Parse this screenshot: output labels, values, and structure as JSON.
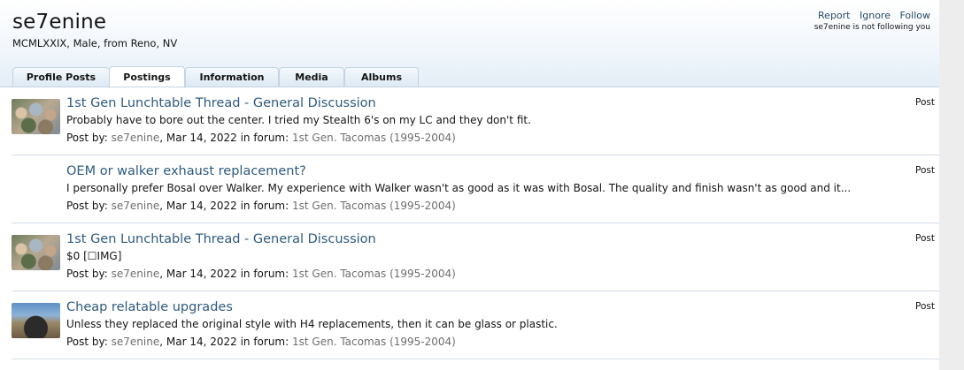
{
  "profile": {
    "username": "se7enine",
    "info": "MCMLXXIX, Male, from Reno, NV"
  },
  "actions": {
    "report": "Report",
    "ignore": "Ignore",
    "follow": "Follow",
    "follow_status": "se7enine is not following you"
  },
  "tabs": [
    {
      "label": "Profile Posts",
      "active": false
    },
    {
      "label": "Postings",
      "active": true
    },
    {
      "label": "Information",
      "active": false
    },
    {
      "label": "Media",
      "active": false
    },
    {
      "label": "Albums",
      "active": false
    }
  ],
  "posts": [
    {
      "title": "1st Gen Lunchtable Thread - General Discussion",
      "snippet": "Probably have to bore out the center. I tried my Stealth 6's on my LC and they don't fit.",
      "post_by_label": "Post by:",
      "author": "se7enine",
      "date": ", Mar 14, 2022 in forum:",
      "forum": "1st Gen. Tacomas (1995-2004)",
      "type": "Post",
      "thumbnail": "lunchtable-photo"
    },
    {
      "title": "OEM or walker exhaust replacement?",
      "snippet": "I personally prefer Bosal over Walker. My experience with Walker wasn't as good as it was with Bosal. The quality and finish wasn't as good and it...",
      "post_by_label": "Post by:",
      "author": "se7enine",
      "date": ", Mar 14, 2022 in forum:",
      "forum": "1st Gen. Tacomas (1995-2004)",
      "type": "Post",
      "thumbnail": ""
    },
    {
      "title": "1st Gen Lunchtable Thread - General Discussion",
      "snippet": "$0 [☐IMG]",
      "post_by_label": "Post by:",
      "author": "se7enine",
      "date": ", Mar 14, 2022 in forum:",
      "forum": "1st Gen. Tacomas (1995-2004)",
      "type": "Post",
      "thumbnail": "lunchtable-photo"
    },
    {
      "title": "Cheap relatable upgrades",
      "snippet": "Unless they replaced the original style with H4 replacements, then it can be glass or plastic.",
      "post_by_label": "Post by:",
      "author": "se7enine",
      "date": ", Mar 14, 2022 in forum:",
      "forum": "1st Gen. Tacomas (1995-2004)",
      "type": "Post",
      "thumbnail": "truck-photo"
    }
  ],
  "colors": {
    "link": "#2f5a7e",
    "muted": "#6e6e6e",
    "header_gradient_end": "#e4eef7",
    "tab_border": "#c4d4e2"
  }
}
